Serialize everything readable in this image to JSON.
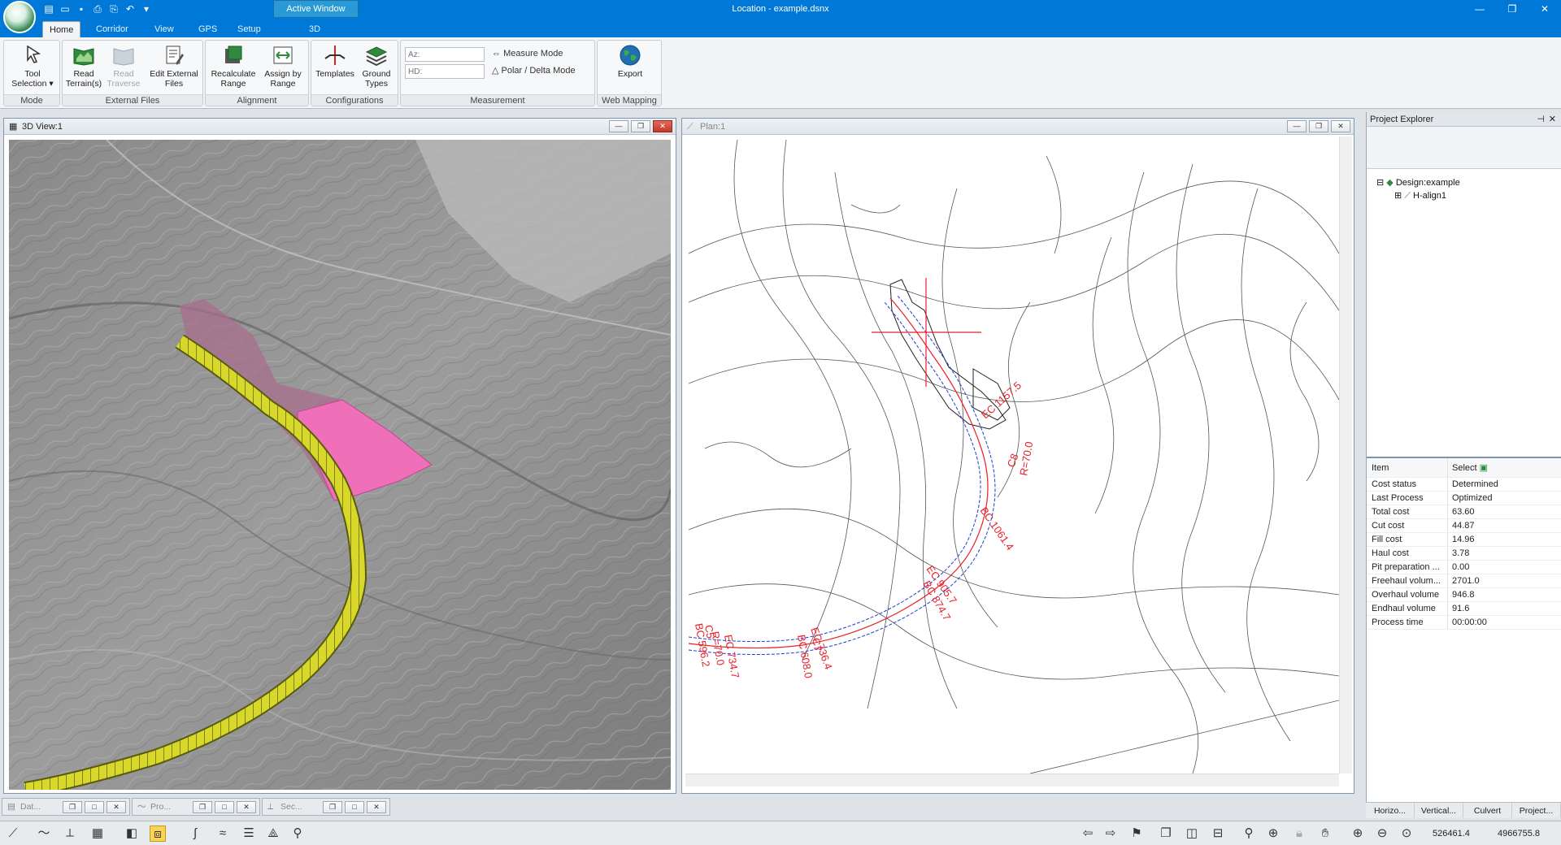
{
  "window": {
    "title": "Location - example.dsnx",
    "active_window_label": "Active Window",
    "minimize": "—",
    "restore": "❐",
    "close": "✕"
  },
  "ribbon_tabs": [
    "Home",
    "Corridor",
    "View",
    "GPS",
    "Setup",
    "3D"
  ],
  "ribbon": {
    "mode": {
      "label": "Mode",
      "tool_selection": "Tool Selection ▾"
    },
    "external_files": {
      "label": "External Files",
      "read_terrain": "Read Terrain(s)",
      "read_traverse": "Read Traverse",
      "edit_external": "Edit External Files"
    },
    "alignment": {
      "label": "Alignment",
      "recalculate": "Recalculate Range",
      "assign": "Assign by Range"
    },
    "configurations": {
      "label": "Configurations",
      "templates": "Templates",
      "ground_types": "Ground Types"
    },
    "measurement": {
      "label": "Measurement",
      "az_placeholder": "Az:",
      "hd_placeholder": "HD:",
      "measure_mode": "Measure Mode",
      "polar_delta": "Polar / Delta Mode"
    },
    "web_mapping": {
      "label": "Web Mapping",
      "export": "Export"
    }
  },
  "view3d": {
    "title": "3D View:1"
  },
  "plan": {
    "title": "Plan:1",
    "labels": [
      {
        "text": "EC 1157.5"
      },
      {
        "text": "C8"
      },
      {
        "text": "R=70.0"
      },
      {
        "text": "BC 1061.4"
      },
      {
        "text": "EC 905.7"
      },
      {
        "text": "BC 874.7"
      },
      {
        "text": "EC 736.4"
      },
      {
        "text": "C7"
      },
      {
        "text": "BC 608.0"
      },
      {
        "text": "EC 734.7"
      },
      {
        "text": "C5"
      },
      {
        "text": "R=70.0"
      },
      {
        "text": "BC 596.2"
      }
    ]
  },
  "project_explorer": {
    "title": "Project Explorer",
    "tree": [
      {
        "label": "Design:example"
      },
      {
        "label": "H-align1"
      }
    ],
    "header_item": "Item",
    "header_value": "Select",
    "properties": [
      {
        "k": "Cost status",
        "v": "Determined"
      },
      {
        "k": "Last Process",
        "v": "Optimized"
      },
      {
        "k": "Total cost",
        "v": "63.60"
      },
      {
        "k": "Cut cost",
        "v": "44.87"
      },
      {
        "k": "Fill cost",
        "v": "14.96"
      },
      {
        "k": "Haul cost",
        "v": "3.78"
      },
      {
        "k": "Pit preparation ...",
        "v": "0.00"
      },
      {
        "k": "Freehaul volum...",
        "v": "2701.0"
      },
      {
        "k": "Overhaul volume",
        "v": "946.8"
      },
      {
        "k": "Endhaul volume",
        "v": "91.6"
      },
      {
        "k": "Process time",
        "v": "00:00:00"
      }
    ],
    "tabs": [
      "Horizo...",
      "Vertical...",
      "Culvert",
      "Project..."
    ]
  },
  "minimized": [
    "Dat...",
    "Pro...",
    "Sec..."
  ],
  "status": {
    "x": "526461.4",
    "y": "4966755.8"
  },
  "colors": {
    "accent": "#0078d7",
    "alignment_red": "#e8202a",
    "alignment_blue": "#1a3fd0",
    "terrain_pink": "#ef6fb8",
    "corridor_yellow": "#d8d82a"
  }
}
